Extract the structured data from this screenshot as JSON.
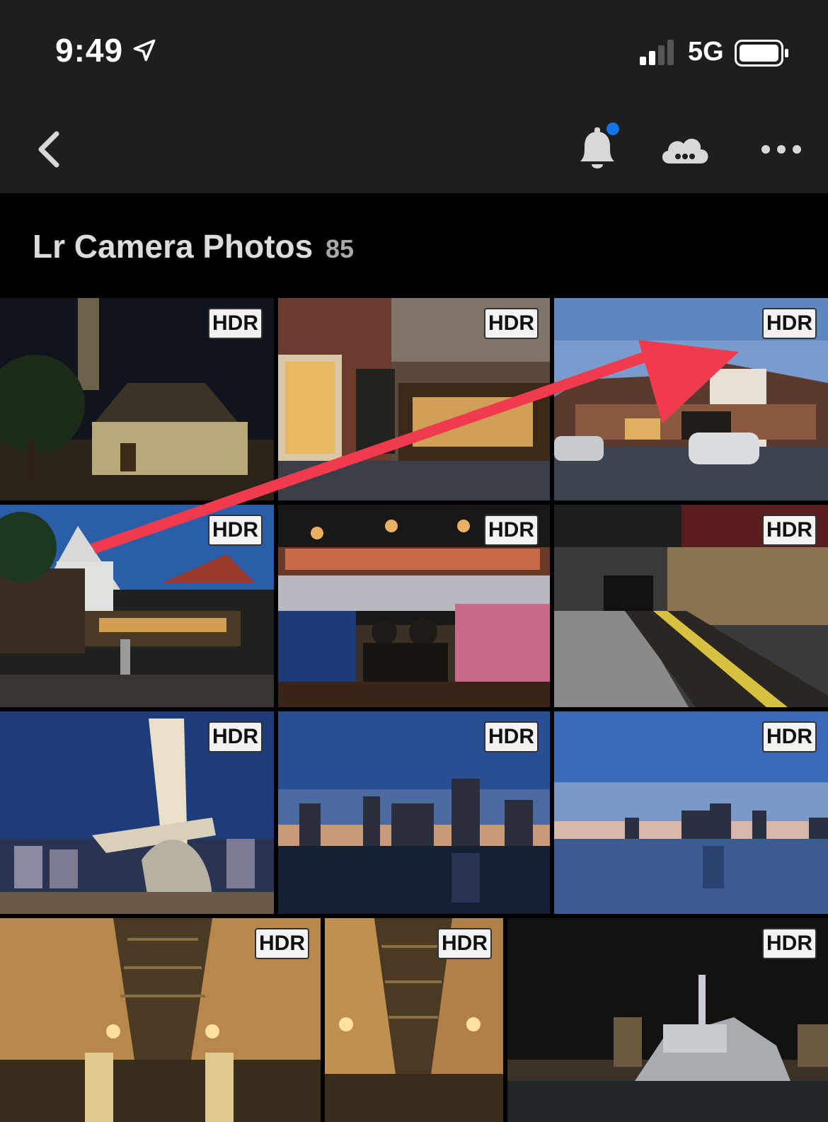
{
  "status_bar": {
    "time": "9:49",
    "network": "5G"
  },
  "nav": {
    "back_icon": "chevron-left-icon",
    "notification_icon": "bell-icon",
    "cloud_icon": "cloud-sync-icon",
    "more_icon": "more-horizontal-icon",
    "notification_dot_color": "#1473e6"
  },
  "album": {
    "title": "Lr Camera Photos",
    "count": "85"
  },
  "photos": [
    {
      "badge": "HDR",
      "subject": "church at night"
    },
    {
      "badge": "HDR",
      "subject": "shop front street"
    },
    {
      "badge": "HDR",
      "subject": "street with houses and car at dusk"
    },
    {
      "badge": "HDR",
      "subject": "pub garden at dusk"
    },
    {
      "badge": "HDR",
      "subject": "bar with bartenders"
    },
    {
      "badge": "HDR",
      "subject": "underground train platform"
    },
    {
      "badge": "HDR",
      "subject": "sculpture at marina night"
    },
    {
      "badge": "HDR",
      "subject": "city skyline over water"
    },
    {
      "badge": "HDR",
      "subject": "skyline reflection at dusk"
    },
    {
      "badge": "HDR",
      "subject": "arcade gallery interior"
    },
    {
      "badge": "HDR",
      "subject": "arcade gallery interior"
    },
    {
      "badge": "HDR",
      "subject": "warship on river at night"
    }
  ],
  "colors": {
    "accent_arrow": "#f03a4e",
    "background": "#000000",
    "bar_background": "#1e1e1e"
  }
}
